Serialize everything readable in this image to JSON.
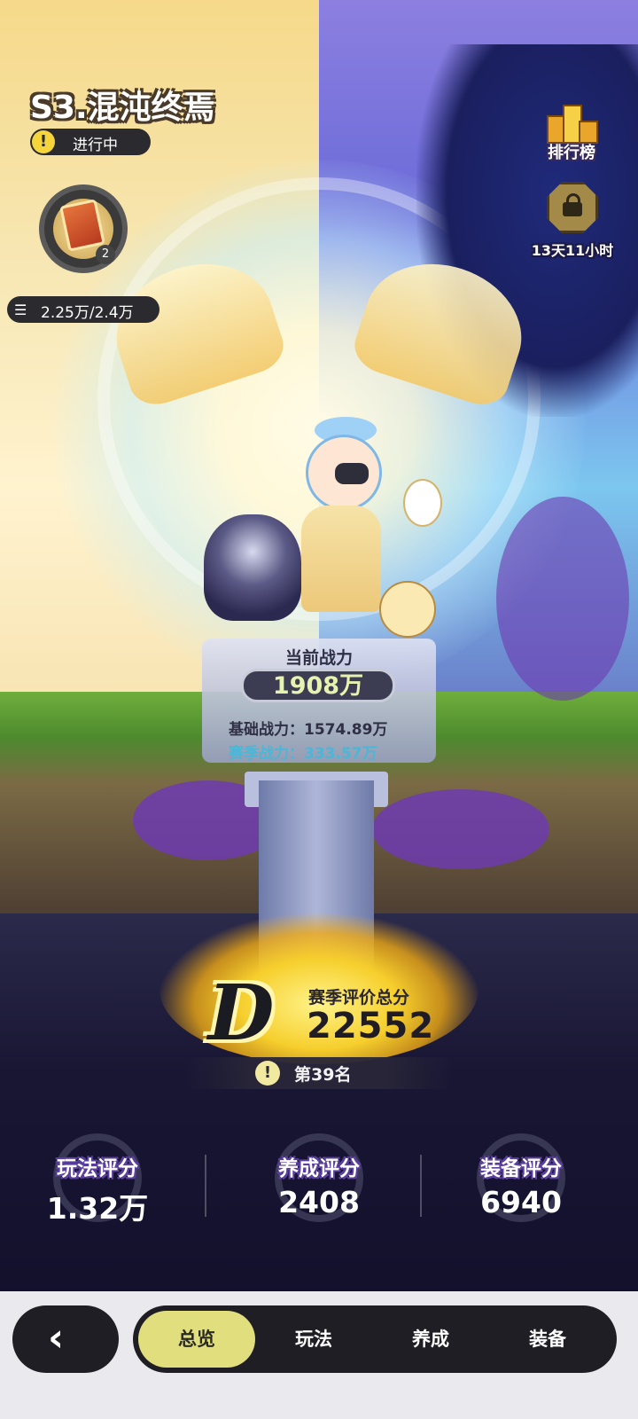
{
  "season": {
    "title": "S3.混沌终焉",
    "status_icon": "!",
    "status": "进行中",
    "card_level": "2",
    "progress_icon": "☰",
    "progress": "2.25万/2.4万"
  },
  "top_right": {
    "ranking_label": "排行榜",
    "timer": "13天11小时"
  },
  "combat": {
    "current_label": "当前战力",
    "current_value": "1908万",
    "base": "基础战力：1574.89万",
    "season": "赛季战力：333.57万"
  },
  "season_score": {
    "grade": "D",
    "label": "赛季评价总分",
    "value": "22552",
    "rank_icon": "!",
    "rank": "第39名"
  },
  "sub_scores": [
    {
      "title": "玩法评分",
      "value": "1.32万"
    },
    {
      "title": "养成评分",
      "value": "2408"
    },
    {
      "title": "装备评分",
      "value": "6940"
    }
  ],
  "nav": {
    "back_icon": "‹",
    "tabs": [
      {
        "label": "总览",
        "active": true
      },
      {
        "label": "玩法",
        "active": false
      },
      {
        "label": "养成",
        "active": false
      },
      {
        "label": "装备",
        "active": false
      }
    ]
  },
  "colors": {
    "accent": "#e1df7d",
    "status_yellow": "#f5d53b",
    "dark_panel": "#1f1e24"
  }
}
